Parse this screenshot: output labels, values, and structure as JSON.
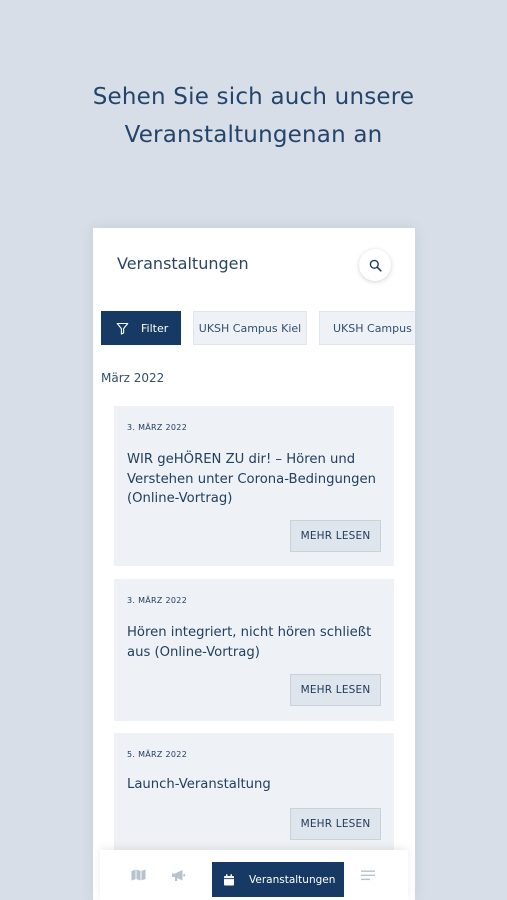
{
  "promo": {
    "headline_line1": "Sehen Sie sich auch unsere",
    "headline_line2": "Veranstaltungenan an"
  },
  "app": {
    "title": "Veranstaltungen"
  },
  "filters": {
    "filter_label": "Filter",
    "chips": [
      "UKSH Campus Kiel",
      "UKSH Campus L"
    ]
  },
  "month_label": "März 2022",
  "events": [
    {
      "date": "3. MÄRZ 2022",
      "title": "WIR geHÖREN ZU dir! – Hören und Verstehen unter Corona-Bedingungen (Online-Vortrag)",
      "button": "MEHR LESEN"
    },
    {
      "date": "3. MÄRZ 2022",
      "title": "Hören integriert, nicht hören schließt aus (Online-Vortrag)",
      "button": "MEHR LESEN"
    },
    {
      "date": "5. MÄRZ 2022",
      "title": "Launch-Veranstaltung",
      "button": "MEHR LESEN"
    }
  ],
  "bottom_nav": {
    "items": [
      {
        "icon": "map-icon"
      },
      {
        "icon": "megaphone-icon"
      },
      {
        "icon": "calendar-icon",
        "label": "Veranstaltungen",
        "active": true
      },
      {
        "icon": "menu-lines-icon"
      }
    ]
  },
  "colors": {
    "background": "#d7dee7",
    "primary": "#163a63",
    "card": "#eef1f5"
  }
}
